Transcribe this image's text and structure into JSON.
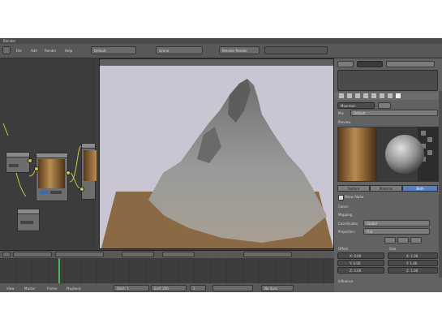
{
  "window": {
    "title": "Blender"
  },
  "menu": {
    "items": [
      "File",
      "Add",
      "Render",
      "Help"
    ],
    "layout_value": "Default",
    "scene_value": "Scene",
    "engine_value": "Blender Render"
  },
  "properties": {
    "material_name": "Mountain",
    "mix_label": "Mix",
    "surface_dropdown": "Default",
    "preview_label": "Preview",
    "preview_tabs": [
      "Texture",
      "Material",
      "Both"
    ],
    "checkbox_label": "Show Alpha",
    "colors_label": "Colors",
    "mapping_label": "Mapping",
    "coordinates_label": "Coordinates:",
    "coordinates_value": "Global",
    "projection_label": "Projection:",
    "projection_value": "Flat",
    "offset_label": "Offset",
    "size_label": "Size",
    "offset_x": "X: 0.00",
    "offset_y": "Y: 0.00",
    "offset_z": "Z: 0.00",
    "size_x": "X: 1.00",
    "size_y": "Y: 1.00",
    "size_z": "Z: 1.00",
    "influence_label": "Influence"
  },
  "timeline": {
    "menu": [
      "View",
      "Marker",
      "Frame",
      "Playback"
    ],
    "start": "Start: 1",
    "end": "End: 250",
    "current": "1",
    "sync": "No Sync"
  },
  "colors": {
    "viewport_bg": "#c9c5d2",
    "terrain_plane": "#8a6a45",
    "mountain": "#8d8d8d",
    "active_tab": "#5680c2",
    "ui_panel": "#626262"
  }
}
